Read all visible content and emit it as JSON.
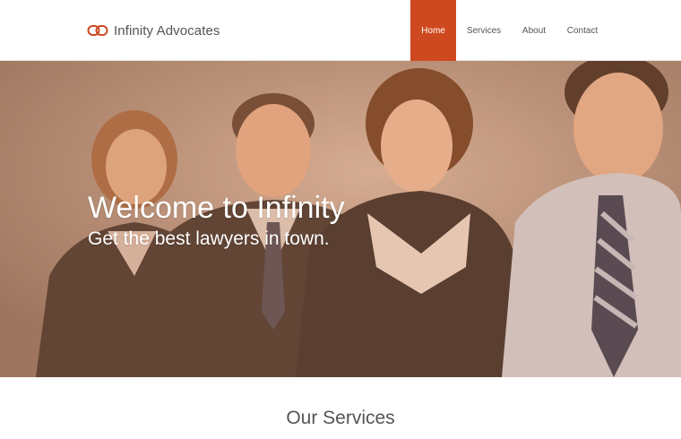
{
  "brand": {
    "name": "Infinity Advocates",
    "logo_icon": "infinity-rings-icon",
    "accent_color": "#cf4920"
  },
  "nav": {
    "items": [
      {
        "label": "Home",
        "active": true
      },
      {
        "label": "Services",
        "active": false
      },
      {
        "label": "About",
        "active": false
      },
      {
        "label": "Contact",
        "active": false
      }
    ]
  },
  "hero": {
    "title": "Welcome to Infinity",
    "subtitle": "Get the best lawyers in town.",
    "overlay_color": "#cd7846"
  },
  "services": {
    "heading": "Our Services"
  }
}
